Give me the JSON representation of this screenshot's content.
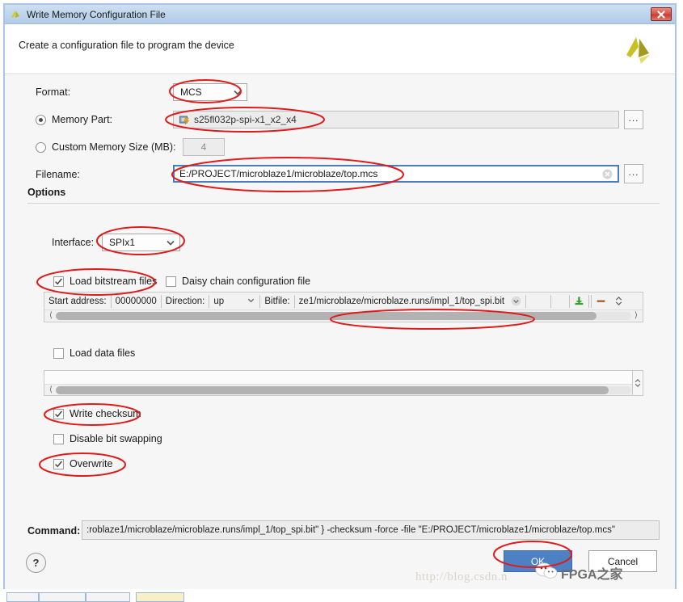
{
  "window": {
    "title": "Write Memory Configuration File",
    "title_icon": "xilinx-logo-icon",
    "close_label": "close-icon",
    "header_text": "Create a configuration file to program the device"
  },
  "form": {
    "format": {
      "label": "Format:",
      "value": "MCS"
    },
    "memory_part": {
      "label": "Memory Part:",
      "value": "s25fl032p-spi-x1_x2_x4",
      "selected": true,
      "browse": "..."
    },
    "custom_memory_size": {
      "label": "Custom Memory Size (MB):",
      "value": "4",
      "selected": false
    },
    "filename": {
      "label": "Filename:",
      "value": "E:/PROJECT/microblaze1/microblaze/top.mcs",
      "browse": "..."
    }
  },
  "options": {
    "title": "Options",
    "interface": {
      "label": "Interface:",
      "value": "SPIx1"
    },
    "load_bitstream_files": {
      "label": "Load bitstream files",
      "checked": true
    },
    "daisy_chain": {
      "label": "Daisy chain configuration file",
      "checked": false
    },
    "bitstream_row": {
      "start_address_label": "Start address:",
      "start_address_value": "00000000",
      "direction_label": "Direction:",
      "direction_value": "up",
      "bitfile_label": "Bitfile:",
      "bitfile_value": "ze1/microblaze/microblaze.runs/impl_1/top_spi.bit",
      "add_icon": "add-green-plus-icon",
      "remove_icon": "remove-minus-icon"
    },
    "load_data_files": {
      "label": "Load data files",
      "checked": false
    },
    "write_checksum": {
      "label": "Write checksum",
      "checked": true
    },
    "disable_bit_swapping": {
      "label": "Disable bit swapping",
      "checked": false
    },
    "overwrite": {
      "label": "Overwrite",
      "checked": true
    }
  },
  "command": {
    "label": "Command:",
    "value": ":roblaze1/microblaze/microblaze.runs/impl_1/top_spi.bit\" } -checksum -force -file \"E:/PROJECT/microblaze1/microblaze/top.mcs\""
  },
  "footer": {
    "help_label": "?",
    "ok_label": "OK",
    "cancel_label": "Cancel"
  },
  "watermarks": {
    "url": "http://blog.csdn.n",
    "cn_text": "FPGA之家"
  },
  "colors": {
    "accent": "#4e80c4",
    "annotation": "#e01b1b",
    "titlebar": "#bed5ec",
    "close": "#d9544a"
  }
}
